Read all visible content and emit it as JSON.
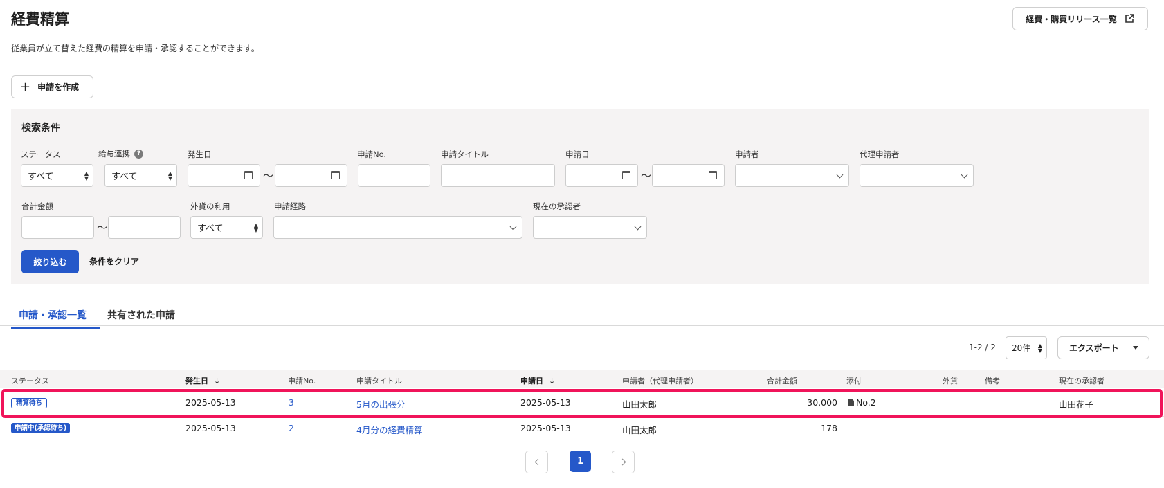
{
  "header": {
    "title": "経費精算",
    "description": "従業員が立て替えた経費の精算を申請・承認することができます。",
    "release_link_label": "経費・購買リリース一覧"
  },
  "create_button_label": "申請を作成",
  "filters": {
    "title": "検索条件",
    "status": {
      "label": "ステータス",
      "value": "すべて"
    },
    "payroll": {
      "label": "給与連携",
      "value": "すべて"
    },
    "occurrence_date": {
      "label": "発生日",
      "tilde": "〜"
    },
    "application_no": {
      "label": "申請No."
    },
    "application_title": {
      "label": "申請タイトル"
    },
    "application_date": {
      "label": "申請日",
      "tilde": "〜"
    },
    "applicant": {
      "label": "申請者"
    },
    "proxy_applicant": {
      "label": "代理申請者"
    },
    "total_amount": {
      "label": "合計金額",
      "tilde": "〜"
    },
    "foreign_currency": {
      "label": "外貨の利用",
      "value": "すべて"
    },
    "route": {
      "label": "申請経路"
    },
    "current_approver": {
      "label": "現在の承認者"
    },
    "apply_label": "絞り込む",
    "clear_label": "条件をクリア"
  },
  "tabs": [
    {
      "label": "申請・承認一覧",
      "active": true
    },
    {
      "label": "共有された申請",
      "active": false
    }
  ],
  "list_controls": {
    "count": "1-2 / 2",
    "per_page": "20件",
    "export_label": "エクスポート"
  },
  "table": {
    "columns": {
      "status": "ステータス",
      "occurrence_date": "発生日",
      "no": "申請No.",
      "title": "申請タイトル",
      "application_date": "申請日",
      "applicant": "申請者（代理申請者）",
      "amount": "合計金額",
      "attachment": "添付",
      "foreign": "外貨",
      "note": "備考",
      "approver": "現在の承認者"
    },
    "sort_arrow": "↓",
    "rows": [
      {
        "status": "精算待ち",
        "status_style": "outline",
        "occurrence_date": "2025-05-13",
        "no": "3",
        "title": "5月の出張分",
        "application_date": "2025-05-13",
        "applicant": "山田太郎",
        "amount": "30,000",
        "attachment": "No.2",
        "foreign": "",
        "note": "",
        "approver": "山田花子",
        "highlighted": true
      },
      {
        "status": "申請中(承認待ち)",
        "status_style": "filled",
        "occurrence_date": "2025-05-13",
        "no": "2",
        "title": "4月分の経費精算",
        "application_date": "2025-05-13",
        "applicant": "山田太郎",
        "amount": "178",
        "attachment": "",
        "foreign": "",
        "note": "",
        "approver": ""
      }
    ]
  },
  "pagination": {
    "current_page": "1"
  },
  "colors": {
    "accent": "#2558c9",
    "highlight_border": "#f0145a",
    "panel_bg": "#f5f3f3"
  }
}
